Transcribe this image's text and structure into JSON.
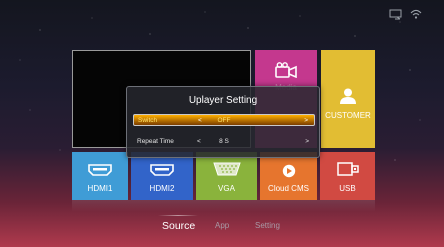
{
  "status_icons": [
    "screen-cast-icon",
    "wifi-icon"
  ],
  "tiles": {
    "media": {
      "label": "Media",
      "icon": "video-camera-icon",
      "color": "#c4388e"
    },
    "customer": {
      "label": "CUSTOMER",
      "icon": "person-icon",
      "color": "#e2bd33"
    },
    "hdmi1": {
      "label": "HDMI1",
      "icon": "hdmi-port-icon",
      "color": "#3f9cd6"
    },
    "hdmi2": {
      "label": "HDMI2",
      "icon": "hdmi-port-icon",
      "color": "#3264c9"
    },
    "vga": {
      "label": "VGA",
      "icon": "vga-port-icon",
      "color": "#8ab33c"
    },
    "cloud": {
      "label": "Cloud CMS",
      "icon": "cloud-icon",
      "color": "#e6752e"
    },
    "usb": {
      "label": "USB",
      "icon": "usb-icon",
      "color": "#d14a42"
    }
  },
  "dialog": {
    "title": "Uplayer Setting",
    "rows": [
      {
        "label": "Switch",
        "value": "OFF",
        "left_arrow": "<",
        "right_arrow": ">",
        "selected": true
      },
      {
        "label": "Repeat Time",
        "value": "8 S",
        "left_arrow": "<",
        "right_arrow": ">",
        "selected": false
      }
    ]
  },
  "nav": {
    "tabs": [
      "Source",
      "App",
      "Setting"
    ],
    "active": "Source"
  },
  "colors": {
    "highlight": "#ffb000",
    "highlight_text": "#ffe36b"
  }
}
